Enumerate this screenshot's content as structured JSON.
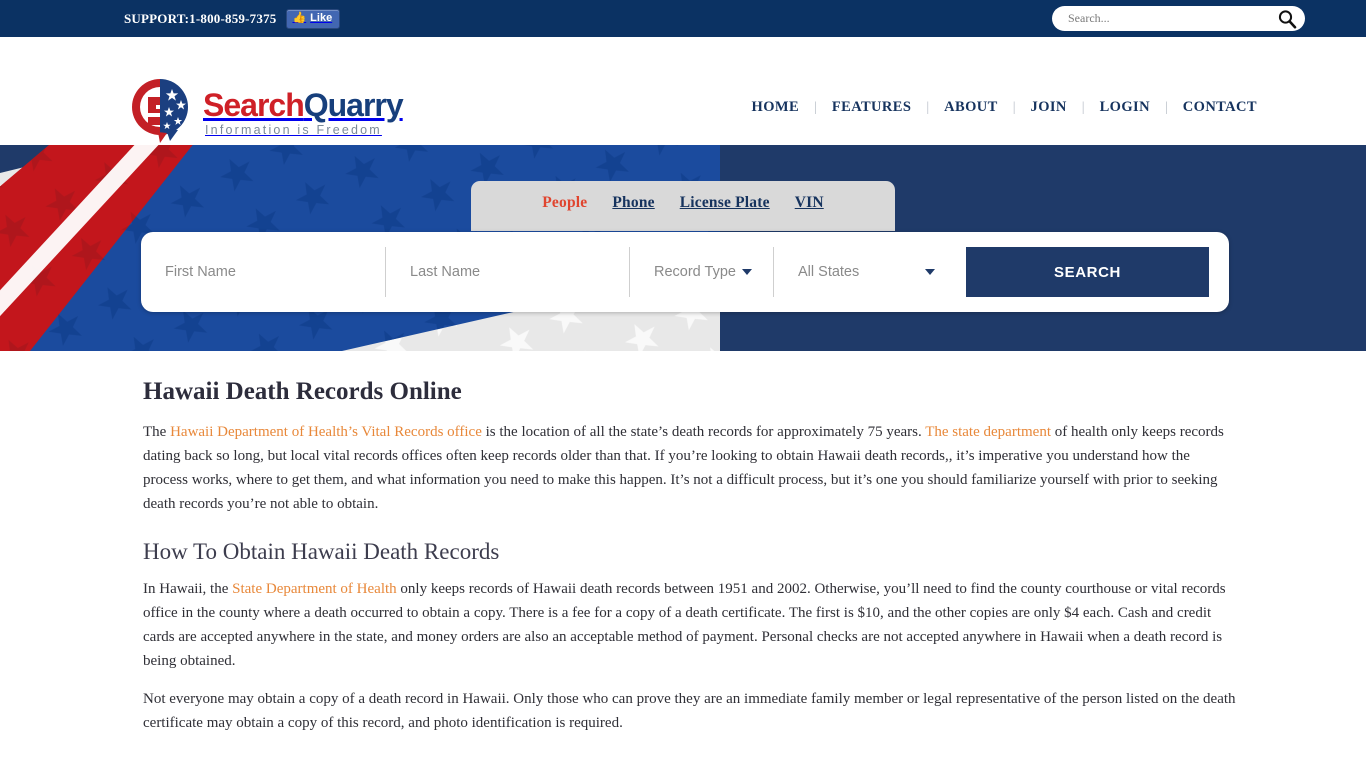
{
  "topbar": {
    "support_label": "SUPPORT:1-800-859-7375",
    "like_label": "Like",
    "search_placeholder": "Search...",
    "search_value": ""
  },
  "header": {
    "logo_text_1": "Search",
    "logo_text_2": "Quarry",
    "logo_tagline": "Information is Freedom",
    "nav": [
      {
        "label": "HOME"
      },
      {
        "label": "FEATURES"
      },
      {
        "label": "ABOUT"
      },
      {
        "label": "JOIN"
      },
      {
        "label": "LOGIN"
      },
      {
        "label": "CONTACT"
      }
    ],
    "separator": "|",
    "page_title": "Hawaii Death Records"
  },
  "hero": {
    "tabs": [
      {
        "label": "People",
        "active": true
      },
      {
        "label": "Phone",
        "active": false
      },
      {
        "label": "License Plate",
        "active": false
      },
      {
        "label": "VIN",
        "active": false
      }
    ],
    "form": {
      "first_name_placeholder": "First Name",
      "first_name_value": "",
      "last_name_placeholder": "Last Name",
      "last_name_value": "",
      "record_type_label": "Record Type",
      "state_label": "All States",
      "search_button": "SEARCH"
    }
  },
  "article": {
    "h1": "Hawaii Death Records Online",
    "p1_a": "The ",
    "p1_link1": "Hawaii Department of Health’s Vital Records office",
    "p1_b": " is the location of all the state’s death records for approximately 75 years. ",
    "p1_link2": "The state department",
    "p1_c": " of health only keeps records dating back so long, but local vital records offices often keep records older than that. If you’re looking to obtain Hawaii death records,, it’s imperative you understand how the process works, where to get them, and what information you need to make this happen. It’s not a difficult process, but it’s one you should familiarize yourself with prior to seeking death records you’re not able to obtain.",
    "h2": "How To Obtain Hawaii Death Records",
    "p2_a": "In Hawaii, the ",
    "p2_link": "State Department of Health",
    "p2_b": " only keeps records of Hawaii death records between 1951 and 2002. Otherwise, you’ll need to find the county courthouse or vital records office in the county where a death occurred to obtain a copy. There is a fee for a copy of a death certificate. The first is $10, and the other copies are only $4 each. Cash and credit cards are accepted anywhere in the state, and money orders are also an acceptable method of payment. Personal checks are not accepted anywhere in Hawaii when a death record is being obtained.",
    "p3": "Not everyone may obtain a copy of a death record in Hawaii. Only those who can prove they are an immediate family member or legal representative of the person listed on the death certificate may obtain a copy of this record, and photo identification is required."
  },
  "colors": {
    "topbar_navy": "#0b3263",
    "hero_navy": "#1f3a69",
    "brand_red": "#cf2027",
    "brand_blue": "#173f7c",
    "link_orange": "#e8883a",
    "tab_active_red": "#e0452f",
    "facebook_blue": "#4267B2"
  }
}
